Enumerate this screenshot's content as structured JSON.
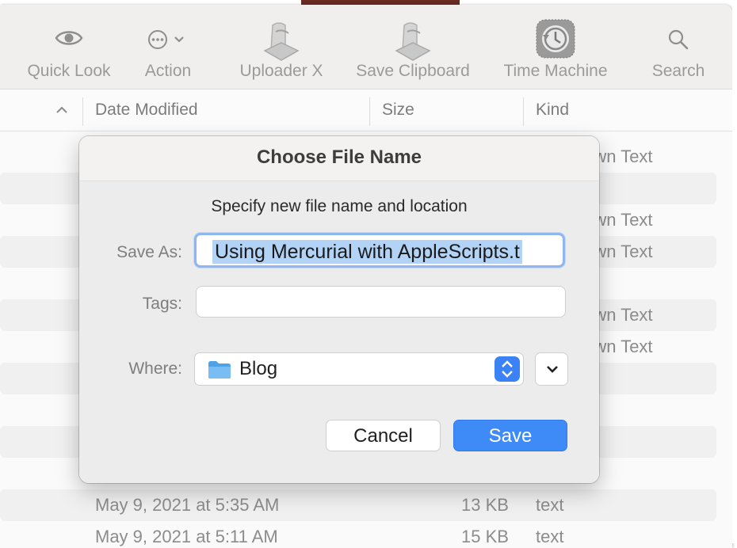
{
  "toolbar": {
    "items": [
      {
        "label": "Quick Look",
        "icon": "eye-icon"
      },
      {
        "label": "Action",
        "icon": "ellipsis-circle-icon"
      },
      {
        "label": "Uploader X",
        "icon": "script-icon"
      },
      {
        "label": "Save Clipboard",
        "icon": "script-icon"
      },
      {
        "label": "Time Machine",
        "icon": "time-machine-icon"
      },
      {
        "label": "Search",
        "icon": "magnifier-icon"
      }
    ]
  },
  "columns": {
    "sort_indicator": "^",
    "date_modified": "Date Modified",
    "size": "Size",
    "kind": "Kind"
  },
  "rows": [
    {
      "kind": "Markdown Text"
    },
    {
      "kind": ""
    },
    {
      "kind": "Markdown Text"
    },
    {
      "kind": "Markdown Text"
    },
    {
      "kind": ""
    },
    {
      "kind": "Markdown Text"
    },
    {
      "kind": "Markdown Text"
    },
    {
      "kind": ""
    },
    {
      "kind": ""
    },
    {
      "kind": ""
    },
    {
      "kind": ""
    },
    {
      "kind": ""
    },
    {
      "date": "May 9, 2021 at 5:35 AM",
      "size": "13 KB",
      "kind": "text"
    },
    {
      "date": "May 9, 2021 at 5:11 AM",
      "size": "15 KB",
      "kind": "text"
    }
  ],
  "dialog": {
    "title": "Choose File Name",
    "subtitle": "Specify new file name and location",
    "save_as_label": "Save As:",
    "save_as_value": "Using Mercurial with AppleScripts.t",
    "tags_label": "Tags:",
    "tags_value": "",
    "where_label": "Where:",
    "where_value": "Blog",
    "cancel_label": "Cancel",
    "save_label": "Save"
  },
  "colors": {
    "accent": "#3e8bf8",
    "selection": "#b3d3f6",
    "focus_ring": "#8fb6ee"
  }
}
